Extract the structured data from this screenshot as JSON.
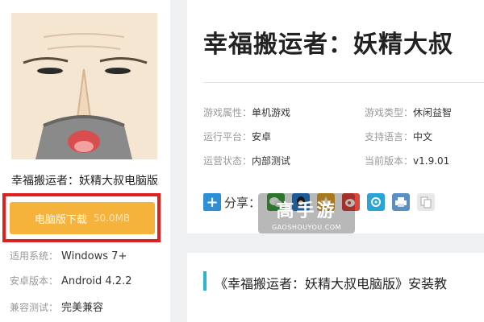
{
  "game": {
    "name": "幸福搬运者：妖精大叔电脑版",
    "title": "幸福搬运者：妖精大叔"
  },
  "download": {
    "label": "电脑版下载",
    "size": "50.0MB"
  },
  "specs": [
    {
      "key": "适用系统：",
      "value": "Windows 7+"
    },
    {
      "key": "安卓版本：",
      "value": "Android 4.2.2"
    },
    {
      "key": "兼容测试：",
      "value": "完美兼容"
    }
  ],
  "attributes": [
    {
      "key": "游戏属性：",
      "value": "单机游戏"
    },
    {
      "key": "游戏类型：",
      "value": "休闲益智"
    },
    {
      "key": "运行平台：",
      "value": "安卓"
    },
    {
      "key": "支持语言：",
      "value": "中文"
    },
    {
      "key": "运营状态：",
      "value": "内部测试"
    },
    {
      "key": "当前版本：",
      "value": "v1.9.01"
    }
  ],
  "share": {
    "label": "分享："
  },
  "watermark": {
    "cn": "高手游",
    "en": "GAOSHOUYOU.COM"
  },
  "section": {
    "title": "《幸福搬运者：妖精大叔电脑版》安装教"
  },
  "colors": {
    "download_button": "#f6b33c",
    "highlight_frame": "#e01f1f",
    "section_accent": "#2bb5c9",
    "share_plus": "#2d8fd6"
  }
}
